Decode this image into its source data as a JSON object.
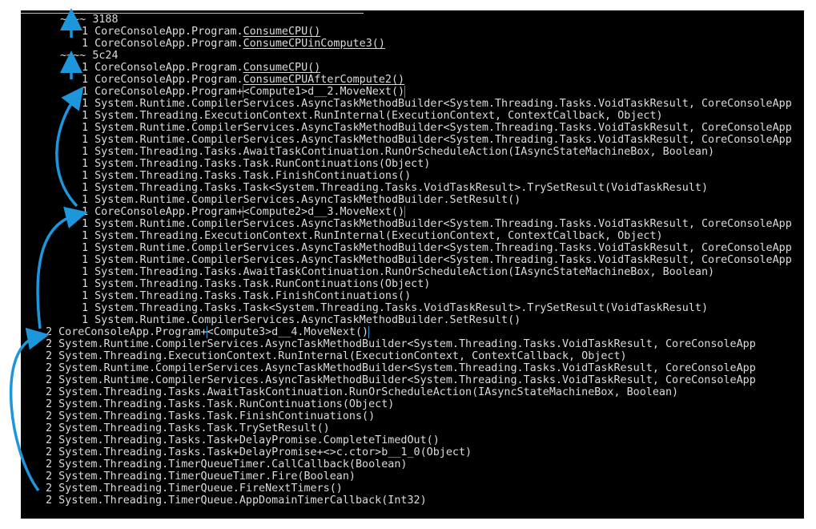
{
  "colors": {
    "background": "#000000",
    "text": "#dcdcdc",
    "annotation": "#1e96dc"
  },
  "lines": [
    {
      "count": "~~~~",
      "prefix": "3188",
      "link": "",
      "suffix": "",
      "indent": "thread"
    },
    {
      "count": "1",
      "prefix": "CoreConsoleApp.Program.",
      "link": "ConsumeCPU()",
      "suffix": "",
      "indent": "inner",
      "style": "underline"
    },
    {
      "count": "1",
      "prefix": "CoreConsoleApp.Program.",
      "link": "ConsumeCPUinCompute3()",
      "suffix": "",
      "indent": "inner",
      "style": "underline"
    },
    {
      "count": "~~~~",
      "prefix": "5c24",
      "link": "",
      "suffix": "",
      "indent": "thread"
    },
    {
      "count": "1",
      "prefix": "CoreConsoleApp.Program.",
      "link": "ConsumeCPU()",
      "suffix": "",
      "indent": "inner",
      "style": "underline"
    },
    {
      "count": "1",
      "prefix": "CoreConsoleApp.Program.",
      "link": "ConsumeCPUAfterCompute2()",
      "suffix": "",
      "indent": "inner",
      "style": "underline"
    },
    {
      "count": "1",
      "prefix": "CoreConsoleApp.Program+",
      "link": "<Compute1>d__2.MoveNext()",
      "suffix": "",
      "indent": "inner",
      "style": "box"
    },
    {
      "count": "1",
      "prefix": "System.Runtime.CompilerServices.AsyncTaskMethodBuilder<System.Threading.Tasks.VoidTaskResult, CoreConsoleApp",
      "link": "",
      "suffix": "",
      "indent": "inner"
    },
    {
      "count": "1",
      "prefix": "System.Threading.ExecutionContext.RunInternal(ExecutionContext, ContextCallback, Object)",
      "link": "",
      "suffix": "",
      "indent": "inner"
    },
    {
      "count": "1",
      "prefix": "System.Runtime.CompilerServices.AsyncTaskMethodBuilder<System.Threading.Tasks.VoidTaskResult, CoreConsoleApp",
      "link": "",
      "suffix": "",
      "indent": "inner"
    },
    {
      "count": "1",
      "prefix": "System.Runtime.CompilerServices.AsyncTaskMethodBuilder<System.Threading.Tasks.VoidTaskResult, CoreConsoleApp",
      "link": "",
      "suffix": "",
      "indent": "inner"
    },
    {
      "count": "1",
      "prefix": "System.Threading.Tasks.AwaitTaskContinuation.RunOrScheduleAction(IAsyncStateMachineBox, Boolean)",
      "link": "",
      "suffix": "",
      "indent": "inner"
    },
    {
      "count": "1",
      "prefix": "System.Threading.Tasks.Task.RunContinuations(Object)",
      "link": "",
      "suffix": "",
      "indent": "inner"
    },
    {
      "count": "1",
      "prefix": "System.Threading.Tasks.Task.FinishContinuations()",
      "link": "",
      "suffix": "",
      "indent": "inner"
    },
    {
      "count": "1",
      "prefix": "System.Threading.Tasks.Task<System.Threading.Tasks.VoidTaskResult>.TrySetResult(VoidTaskResult)",
      "link": "",
      "suffix": "",
      "indent": "inner"
    },
    {
      "count": "1",
      "prefix": "System.Runtime.CompilerServices.AsyncTaskMethodBuilder.SetResult()",
      "link": "",
      "suffix": "",
      "indent": "inner"
    },
    {
      "count": "1",
      "prefix": "CoreConsoleApp.Program+",
      "link": "<Compute2>d__3.MoveNext()",
      "suffix": "",
      "indent": "inner",
      "style": "box"
    },
    {
      "count": "1",
      "prefix": "System.Runtime.CompilerServices.AsyncTaskMethodBuilder<System.Threading.Tasks.VoidTaskResult, CoreConsoleApp",
      "link": "",
      "suffix": "",
      "indent": "inner"
    },
    {
      "count": "1",
      "prefix": "System.Threading.ExecutionContext.RunInternal(ExecutionContext, ContextCallback, Object)",
      "link": "",
      "suffix": "",
      "indent": "inner"
    },
    {
      "count": "1",
      "prefix": "System.Runtime.CompilerServices.AsyncTaskMethodBuilder<System.Threading.Tasks.VoidTaskResult, CoreConsoleApp",
      "link": "",
      "suffix": "",
      "indent": "inner"
    },
    {
      "count": "1",
      "prefix": "System.Runtime.CompilerServices.AsyncTaskMethodBuilder<System.Threading.Tasks.VoidTaskResult, CoreConsoleApp",
      "link": "",
      "suffix": "",
      "indent": "inner"
    },
    {
      "count": "1",
      "prefix": "System.Threading.Tasks.AwaitTaskContinuation.RunOrScheduleAction(IAsyncStateMachineBox, Boolean)",
      "link": "",
      "suffix": "",
      "indent": "inner"
    },
    {
      "count": "1",
      "prefix": "System.Threading.Tasks.Task.RunContinuations(Object)",
      "link": "",
      "suffix": "",
      "indent": "inner"
    },
    {
      "count": "1",
      "prefix": "System.Threading.Tasks.Task.FinishContinuations()",
      "link": "",
      "suffix": "",
      "indent": "inner"
    },
    {
      "count": "1",
      "prefix": "System.Threading.Tasks.Task<System.Threading.Tasks.VoidTaskResult>.TrySetResult(VoidTaskResult)",
      "link": "",
      "suffix": "",
      "indent": "inner"
    },
    {
      "count": "1",
      "prefix": "System.Runtime.CompilerServices.AsyncTaskMethodBuilder.SetResult()",
      "link": "",
      "suffix": "",
      "indent": "inner"
    },
    {
      "count": "2",
      "prefix": "CoreConsoleApp.Program+",
      "link": "<Compute3>d__4.MoveNext()",
      "suffix": "",
      "indent": "outer",
      "style": "box"
    },
    {
      "count": "2",
      "prefix": "System.Runtime.CompilerServices.AsyncTaskMethodBuilder<System.Threading.Tasks.VoidTaskResult, CoreConsoleApp",
      "link": "",
      "suffix": "",
      "indent": "outer"
    },
    {
      "count": "2",
      "prefix": "System.Threading.ExecutionContext.RunInternal(ExecutionContext, ContextCallback, Object)",
      "link": "",
      "suffix": "",
      "indent": "outer"
    },
    {
      "count": "2",
      "prefix": "System.Runtime.CompilerServices.AsyncTaskMethodBuilder<System.Threading.Tasks.VoidTaskResult, CoreConsoleApp",
      "link": "",
      "suffix": "",
      "indent": "outer"
    },
    {
      "count": "2",
      "prefix": "System.Runtime.CompilerServices.AsyncTaskMethodBuilder<System.Threading.Tasks.VoidTaskResult, CoreConsoleApp",
      "link": "",
      "suffix": "",
      "indent": "outer"
    },
    {
      "count": "2",
      "prefix": "System.Threading.Tasks.AwaitTaskContinuation.RunOrScheduleAction(IAsyncStateMachineBox, Boolean)",
      "link": "",
      "suffix": "",
      "indent": "outer"
    },
    {
      "count": "2",
      "prefix": "System.Threading.Tasks.Task.RunContinuations(Object)",
      "link": "",
      "suffix": "",
      "indent": "outer"
    },
    {
      "count": "2",
      "prefix": "System.Threading.Tasks.Task.FinishContinuations()",
      "link": "",
      "suffix": "",
      "indent": "outer"
    },
    {
      "count": "2",
      "prefix": "System.Threading.Tasks.Task.TrySetResult()",
      "link": "",
      "suffix": "",
      "indent": "outer"
    },
    {
      "count": "2",
      "prefix": "System.Threading.Tasks.Task+DelayPromise.CompleteTimedOut()",
      "link": "",
      "suffix": "",
      "indent": "outer"
    },
    {
      "count": "2",
      "prefix": "System.Threading.Tasks.Task+DelayPromise+<>c.ctor>b__1_0(Object)",
      "link": "",
      "suffix": "",
      "indent": "outer"
    },
    {
      "count": "2",
      "prefix": "System.Threading.TimerQueueTimer.CallCallback(Boolean)",
      "link": "",
      "suffix": "",
      "indent": "outer"
    },
    {
      "count": "2",
      "prefix": "System.Threading.TimerQueueTimer.Fire(Boolean)",
      "link": "",
      "suffix": "",
      "indent": "outer"
    },
    {
      "count": "2",
      "prefix": "System.Threading.TimerQueue.FireNextTimers()",
      "link": "",
      "suffix": "",
      "indent": "outer"
    },
    {
      "count": "2",
      "prefix": "System.Threading.TimerQueue.AppDomainTimerCallback(Int32)",
      "link": "",
      "suffix": "",
      "indent": "outer"
    }
  ]
}
